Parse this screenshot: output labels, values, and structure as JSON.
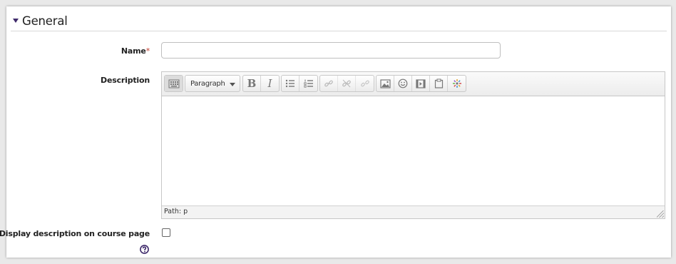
{
  "section": {
    "title": "General",
    "toggle_icon": "caret-down-icon"
  },
  "fields": {
    "name": {
      "label": "Name",
      "required_marker": "*",
      "value": ""
    },
    "description": {
      "label": "Description",
      "format_selected": "Paragraph",
      "status_path": "Path: p",
      "content": ""
    },
    "display_description": {
      "label": "Display description on course page",
      "checked": false,
      "help_icon": "help-icon"
    }
  },
  "toolbar": {
    "toggle_icon": "toolbar-toggle-icon",
    "bold_label": "B",
    "italic_label": "I",
    "icons": [
      "unordered-list-icon",
      "ordered-list-icon",
      "link-icon",
      "unlink-icon",
      "anchor-icon",
      "image-icon",
      "emoticon-icon",
      "media-icon",
      "paste-icon",
      "spellcheck-icon"
    ]
  },
  "colors": {
    "accent": "#3f2a6b",
    "required": "#c0392b",
    "help": "#3f2a6b"
  }
}
